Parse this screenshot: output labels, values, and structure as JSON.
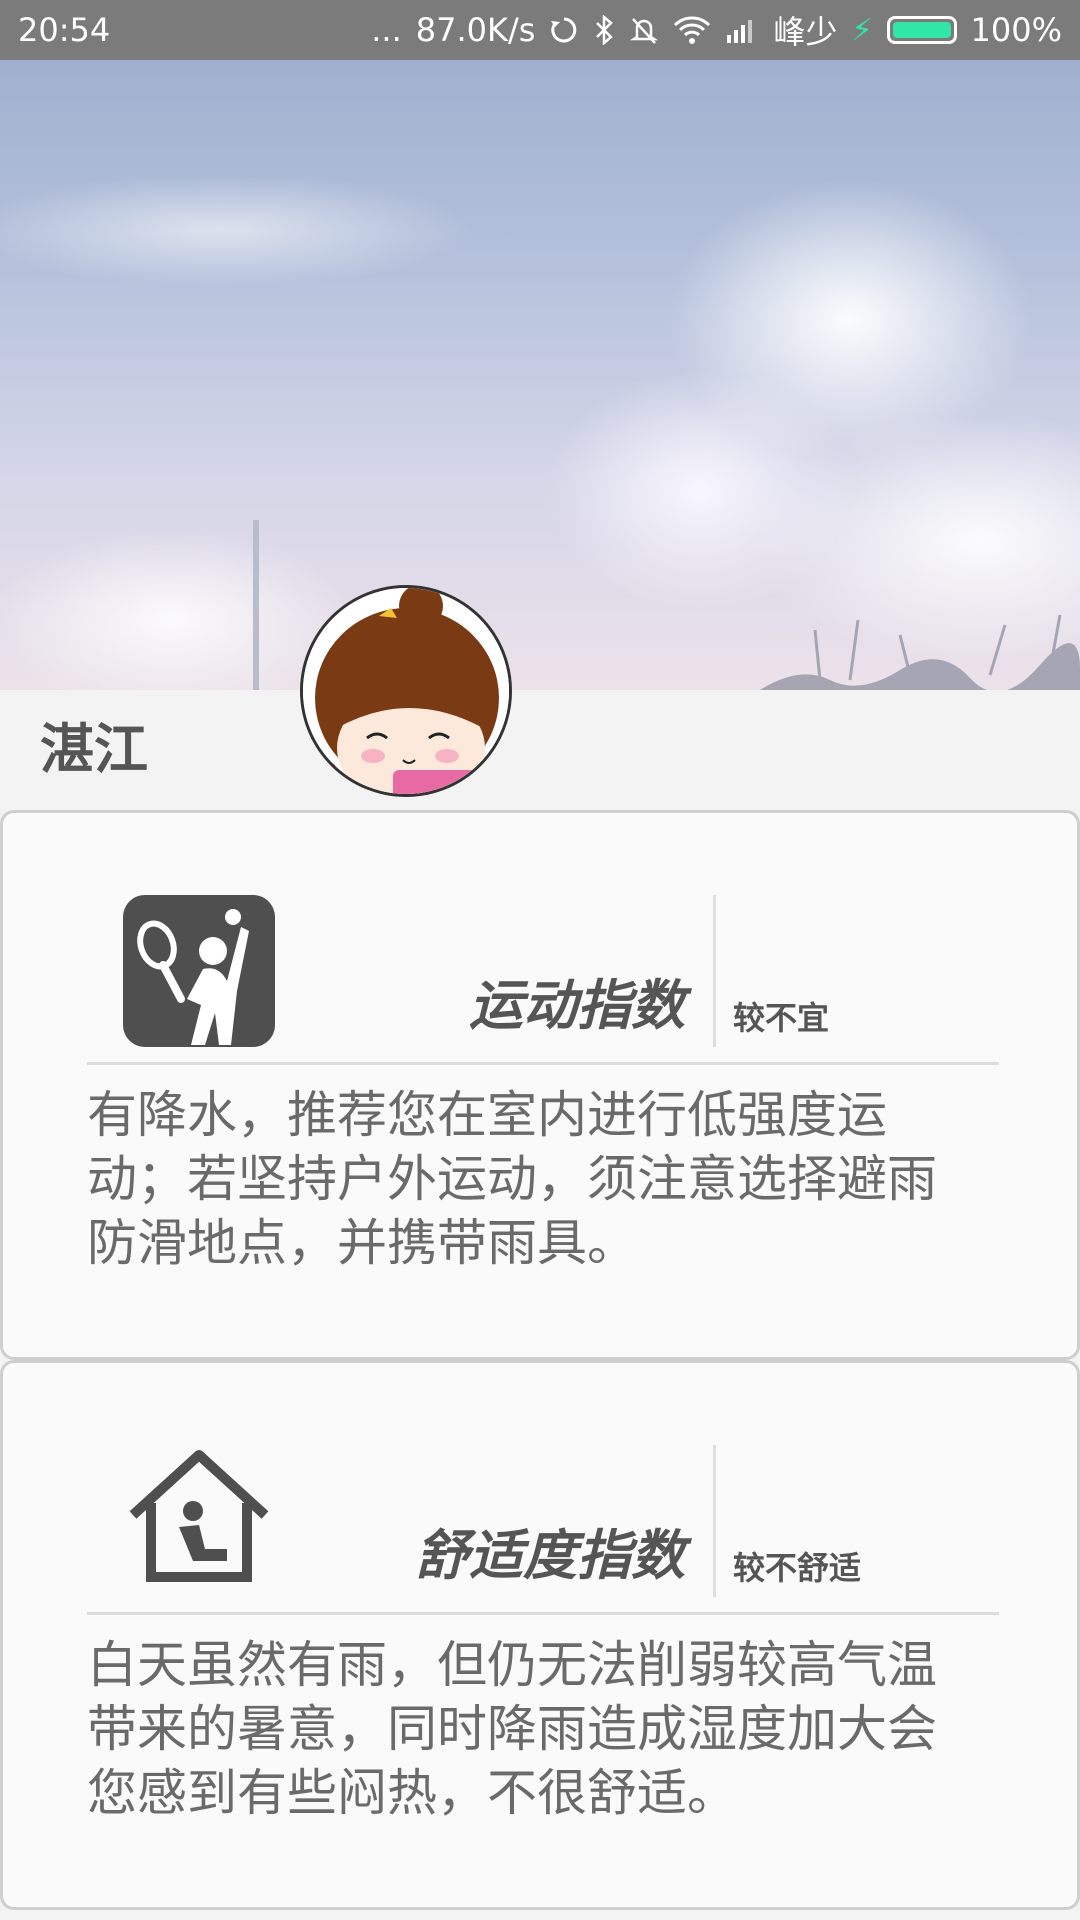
{
  "status_bar": {
    "time": "20:54",
    "dots": "...",
    "net_speed": "87.0K/s",
    "carrier": "峰少",
    "battery": "100%",
    "icons": [
      "sync-icon",
      "bluetooth-icon",
      "mute-bell-icon",
      "wifi-icon",
      "signal-icon",
      "charging-icon",
      "battery-icon"
    ]
  },
  "header": {
    "city": "湛江"
  },
  "cards": [
    {
      "icon": "tennis-player-icon",
      "title": "运动指数",
      "status": "较不宜",
      "text": "有降水，推荐您在室内进行低强度运动；若坚持户外运动，须注意选择避雨防滑地点，并携带雨具。"
    },
    {
      "icon": "house-person-icon",
      "title": "舒适度指数",
      "status": "较不舒适",
      "text": "白天虽然有雨，但仍无法削弱较高气温带来的暑意，同时降雨造成湿度加大会您感到有些闷热，不很舒适。"
    }
  ],
  "colors": {
    "status_bar_bg": "#7b7b7b",
    "battery_accent": "#31e6a6",
    "text_dark": "#555555",
    "card_border": "#cfcfcf"
  }
}
